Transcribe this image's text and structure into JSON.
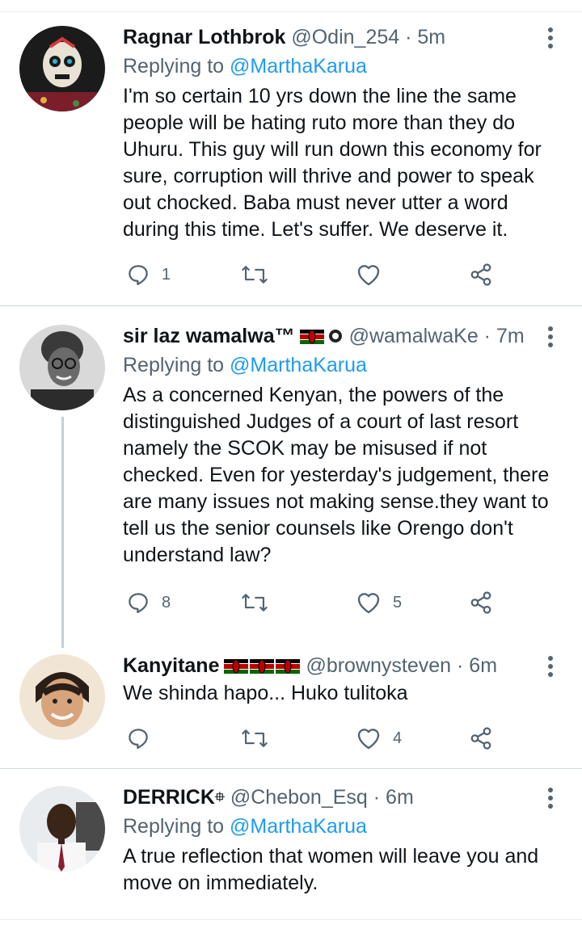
{
  "tweets": [
    {
      "name": "Ragnar Lothbrok",
      "handle": "@Odin_254",
      "time": "· 5m",
      "replying_prefix": "Replying to ",
      "replying_to": "@MarthaKarua",
      "text": "I'm so certain 10 yrs down the line the same people will be hating ruto more than they do Uhuru. This guy will run down this economy for sure, corruption will thrive and power to speak out chocked. Baba must never utter a word during this time. Let's suffer. We deserve it.",
      "replies": "1",
      "retweets": "",
      "likes": ""
    },
    {
      "name": "sir laz wamalwa™",
      "handle": "@wamalwaKe",
      "time": "· 7m",
      "replying_prefix": "Replying to ",
      "replying_to": "@MarthaKarua",
      "text": "As a concerned Kenyan, the powers of the distinguished Judges of a court of last resort namely the SCOK may be misused if not checked. Even for yesterday's judgement, there are many issues not making sense.they want to tell us the senior counsels like Orengo don't understand law?",
      "replies": "8",
      "retweets": "",
      "likes": "5"
    },
    {
      "name": "Kanyitane",
      "handle": "@brownysteven",
      "time": "· 6m",
      "text": "We shinda hapo... Huko tulitoka",
      "replies": "",
      "retweets": "",
      "likes": "4"
    },
    {
      "name": "DERRICK",
      "name_suffix_glyph": "⯐",
      "handle": "@Chebon_Esq",
      "time": "· 6m",
      "replying_prefix": "Replying to ",
      "replying_to": "@MarthaKarua",
      "text": "A true reflection that women will leave you and move on immediately."
    }
  ],
  "icons": {
    "reply": "reply-icon",
    "retweet": "retweet-icon",
    "like": "heart-icon",
    "share": "share-icon",
    "more": "more-vertical-icon",
    "flag": "kenya-flag-icon"
  },
  "colors": {
    "link": "#1d9bf0",
    "secondary": "#536471",
    "text": "#0f1419",
    "separator": "#cfd9de"
  }
}
